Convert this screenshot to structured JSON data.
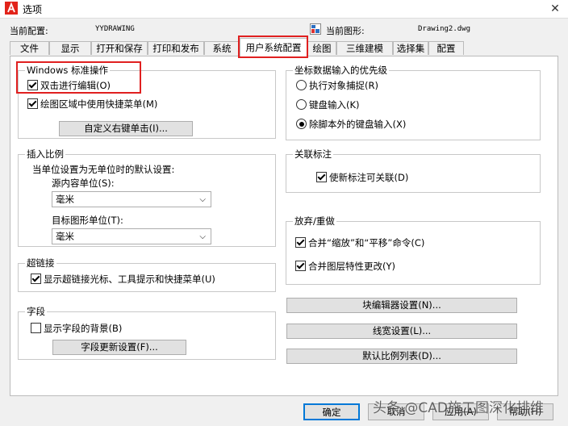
{
  "window": {
    "title": "选项"
  },
  "profile": {
    "current_profile_label": "当前配置:",
    "current_profile_value": "YYDRAWING",
    "current_drawing_label": "当前图形:",
    "current_drawing_value": "Drawing2.dwg"
  },
  "tabs": [
    "文件",
    "显示",
    "打开和保存",
    "打印和发布",
    "系统",
    "用户系统配置",
    "绘图",
    "三维建模",
    "选择集",
    "配置"
  ],
  "windows_ops": {
    "title": "Windows 标准操作",
    "double_click_edit": "双击进行编辑(O)",
    "double_click_checked": true,
    "shortcut_menu": "绘图区域中使用快捷菜单(M)",
    "shortcut_checked": true,
    "right_click_button": "自定义右键单击(I)..."
  },
  "insert_scale": {
    "title": "插入比例",
    "subtitle": "当单位设置为无单位时的默认设置:",
    "source_label": "源内容单位(S):",
    "source_value": "毫米",
    "target_label": "目标图形单位(T):",
    "target_value": "毫米"
  },
  "hyperlink": {
    "title": "超链接",
    "show_cursor": "显示超链接光标、工具提示和快捷菜单(U)",
    "show_cursor_checked": true
  },
  "fields": {
    "title": "字段",
    "show_background": "显示字段的背景(B)",
    "show_background_checked": false,
    "update_button": "字段更新设置(F)..."
  },
  "coord_priority": {
    "title": "坐标数据输入的优先级",
    "option1": "执行对象捕捉(R)",
    "option2": "键盘输入(K)",
    "option3": "除脚本外的键盘输入(X)",
    "selected": 3
  },
  "assoc_dim": {
    "title": "关联标注",
    "make_assoc": "使新标注可关联(D)",
    "make_assoc_checked": true
  },
  "undo_redo": {
    "title": "放弃/重做",
    "combine_zoom_pan": "合并“缩放”和“平移”命令(C)",
    "combine_zoom_pan_checked": true,
    "combine_layer": "合并图层特性更改(Y)",
    "combine_layer_checked": true
  },
  "right_buttons": {
    "block_editor": "块编辑器设置(N)...",
    "lineweight": "线宽设置(L)...",
    "scale_list": "默认比例列表(D)..."
  },
  "dialog_buttons": {
    "ok": "确定",
    "cancel": "取消",
    "apply": "应用(A)",
    "help": "帮助(H)"
  },
  "watermark": "头条 @CAD施工图深化排维"
}
